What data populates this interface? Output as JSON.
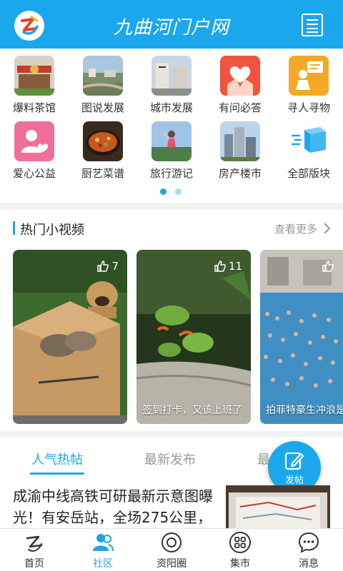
{
  "header": {
    "title": "九曲河门户网",
    "logo_icon": "brand-logo-icon",
    "menu_icon": "menu-list-icon",
    "color": "#1aa7ec"
  },
  "grid": [
    {
      "label": "爆料茶馆",
      "icon": "tea-house-photo"
    },
    {
      "label": "图说发展",
      "icon": "development-photo"
    },
    {
      "label": "城市发展",
      "icon": "city-photo"
    },
    {
      "label": "有问必答",
      "icon": "heart-hands-icon"
    },
    {
      "label": "寻人寻物",
      "icon": "person-notice-icon"
    },
    {
      "label": "爱心公益",
      "icon": "charity-heart-icon"
    },
    {
      "label": "厨艺菜谱",
      "icon": "cooking-photo"
    },
    {
      "label": "旅行游记",
      "icon": "travel-photo"
    },
    {
      "label": "房产楼市",
      "icon": "real-estate-photo"
    },
    {
      "label": "全部版块",
      "icon": "all-sections-box-icon"
    }
  ],
  "pager": {
    "pages": 2,
    "current": 1
  },
  "hot_videos": {
    "title": "热门小视频",
    "more": "查看更多",
    "items": [
      {
        "likes": "7",
        "caption": ""
      },
      {
        "likes": "11",
        "caption": "签到打卡，又该上班了"
      },
      {
        "likes": "",
        "caption": "拍菲特豪生冲浪是"
      }
    ]
  },
  "tabs": [
    {
      "label": "人气热帖",
      "active": true
    },
    {
      "label": "最新发布",
      "active": false
    },
    {
      "label": "最",
      "active": false
    }
  ],
  "fab": {
    "label": "发帖",
    "icon": "edit-pen-icon"
  },
  "post": {
    "title": "成渝中线高铁可研最新示意图曝光！有安岳站，全场275公里，"
  },
  "bottom_nav": [
    {
      "label": "首页",
      "icon": "home-logo-icon",
      "active": false
    },
    {
      "label": "社区",
      "icon": "community-people-icon",
      "active": true
    },
    {
      "label": "资阳圈",
      "icon": "circle-icon",
      "active": false
    },
    {
      "label": "集市",
      "icon": "market-grid-icon",
      "active": false
    },
    {
      "label": "消息",
      "icon": "message-bubble-icon",
      "active": false
    }
  ]
}
